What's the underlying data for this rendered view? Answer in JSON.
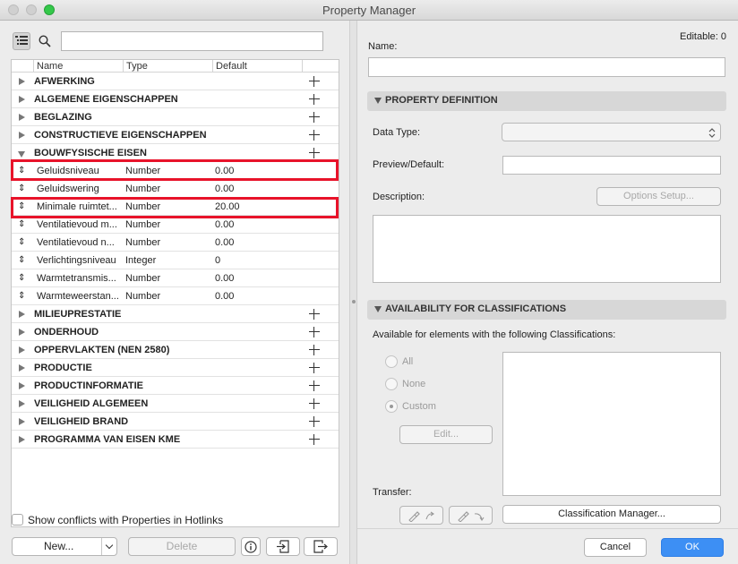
{
  "window": {
    "title": "Property Manager"
  },
  "search": {
    "value": "",
    "placeholder": ""
  },
  "columns": {
    "name": "Name",
    "type": "Type",
    "default": "Default"
  },
  "groups_before": [
    "AFWERKING",
    "ALGEMENE EIGENSCHAPPEN",
    "BEGLAZING",
    "CONSTRUCTIEVE EIGENSCHAPPEN"
  ],
  "open_group": "BOUWFYSISCHE EISEN",
  "properties": [
    {
      "name": "Geluidsniveau",
      "type": "Number",
      "default": "0.00",
      "highlighted": true
    },
    {
      "name": "Geluidswering",
      "type": "Number",
      "default": "0.00"
    },
    {
      "name": "Minimale ruimtet...",
      "type": "Number",
      "default": "20.00",
      "highlighted": true
    },
    {
      "name": "Ventilatievoud m...",
      "type": "Number",
      "default": "0.00"
    },
    {
      "name": "Ventilatievoud n...",
      "type": "Number",
      "default": "0.00"
    },
    {
      "name": "Verlichtingsniveau",
      "type": "Integer",
      "default": "0"
    },
    {
      "name": "Warmtetransmis...",
      "type": "Number",
      "default": "0.00"
    },
    {
      "name": "Warmteweerstan...",
      "type": "Number",
      "default": "0.00"
    }
  ],
  "groups_after": [
    "MILIEUPRESTATIE",
    "ONDERHOUD",
    "OPPERVLAKTEN (NEN 2580)",
    "PRODUCTIE",
    "PRODUCTINFORMATIE",
    "VEILIGHEID ALGEMEEN",
    "VEILIGHEID BRAND",
    "PROGRAMMA VAN EISEN KME"
  ],
  "footer": {
    "conflicts_label": "Show conflicts with Properties in Hotlinks",
    "new_label": "New...",
    "delete_label": "Delete"
  },
  "right": {
    "editable": "Editable: 0",
    "name_label": "Name:",
    "name_value": "",
    "property_definition": "PROPERTY DEFINITION",
    "data_type_label": "Data Type:",
    "data_type_value": "",
    "preview_label": "Preview/Default:",
    "preview_value": "",
    "description_label": "Description:",
    "options_setup": "Options Setup...",
    "description_value": "",
    "availability": "AVAILABILITY FOR CLASSIFICATIONS",
    "available_text": "Available for elements with the following Classifications:",
    "radio_all": "All",
    "radio_none": "None",
    "radio_custom": "Custom",
    "edit_label": "Edit...",
    "transfer_label": "Transfer:",
    "classification_manager": "Classification Manager...",
    "cancel": "Cancel",
    "ok": "OK"
  },
  "colors": {
    "highlight": "#e8132a",
    "accent": "#3d8ff4"
  }
}
